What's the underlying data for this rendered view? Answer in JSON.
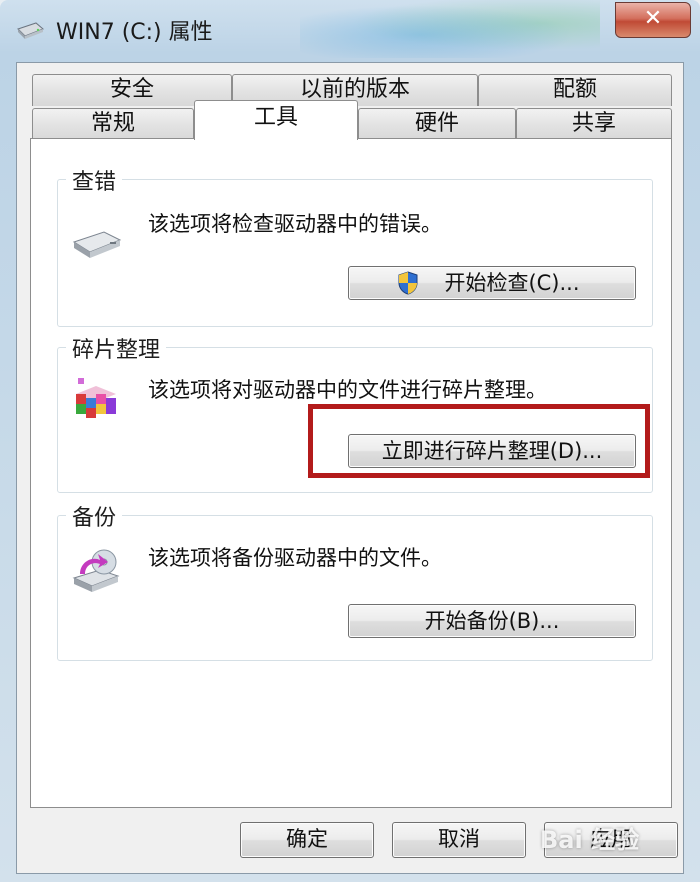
{
  "window": {
    "title": "WIN7 (C:) 属性",
    "close_label": "✕"
  },
  "tabs": {
    "row_top": [
      {
        "label": "安全"
      },
      {
        "label": "以前的版本"
      },
      {
        "label": "配额"
      }
    ],
    "row_bottom": [
      {
        "label": "常规"
      },
      {
        "label": "工具"
      },
      {
        "label": "硬件"
      },
      {
        "label": "共享"
      }
    ],
    "active": "工具"
  },
  "groups": {
    "check": {
      "title": "查错",
      "description": "该选项将检查驱动器中的错误。",
      "button_label": "开始检查(C)..."
    },
    "defrag": {
      "title": "碎片整理",
      "description": "该选项将对驱动器中的文件进行碎片整理。",
      "button_label": "立即进行碎片整理(D)..."
    },
    "backup": {
      "title": "备份",
      "description": "该选项将备份驱动器中的文件。",
      "button_label": "开始备份(B)..."
    }
  },
  "footer": {
    "ok_label": "确定",
    "cancel_label": "取消",
    "apply_label": "应用"
  },
  "watermark": {
    "text": "Bai 经验"
  },
  "colors": {
    "highlight_border": "#b31b1b",
    "uac_shield_blue": "#2f6fd1",
    "uac_shield_yellow": "#f2c53d"
  }
}
